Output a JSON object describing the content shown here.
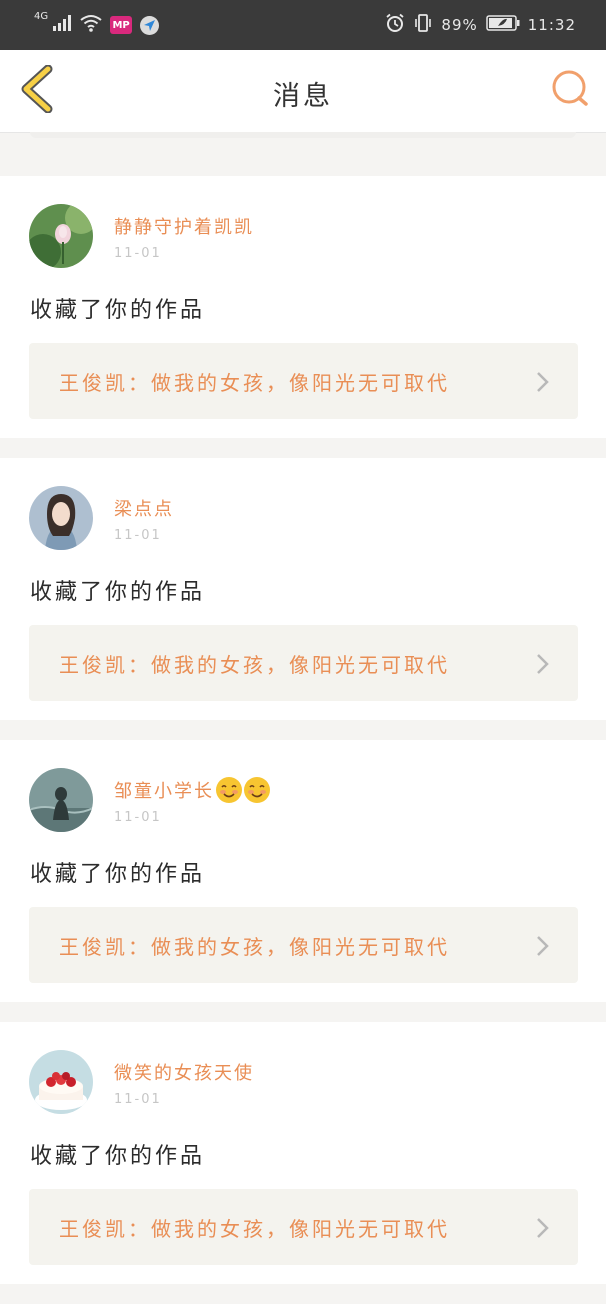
{
  "status_bar": {
    "network": "4G",
    "app_icon_1": "MP",
    "battery": "89%",
    "time": "11:32"
  },
  "header": {
    "title": "消息"
  },
  "colors": {
    "accent": "#e98e55",
    "status_bar": "#3a3a3a",
    "link_bg": "#f4f3ee"
  },
  "messages": [
    {
      "username": "静静守护着凯凯",
      "date": "11-01",
      "action": "收藏了你的作品",
      "work_title": "王俊凯：做我的女孩，像阳光无可取代"
    },
    {
      "username": "梁点点",
      "date": "11-01",
      "action": "收藏了你的作品",
      "work_title": "王俊凯：做我的女孩，像阳光无可取代"
    },
    {
      "username": "邹童小学长",
      "date": "11-01",
      "action": "收藏了你的作品",
      "work_title": "王俊凯：做我的女孩，像阳光无可取代"
    },
    {
      "username": "微笑的女孩天使",
      "date": "11-01",
      "action": "收藏了你的作品",
      "work_title": "王俊凯：做我的女孩，像阳光无可取代"
    }
  ]
}
